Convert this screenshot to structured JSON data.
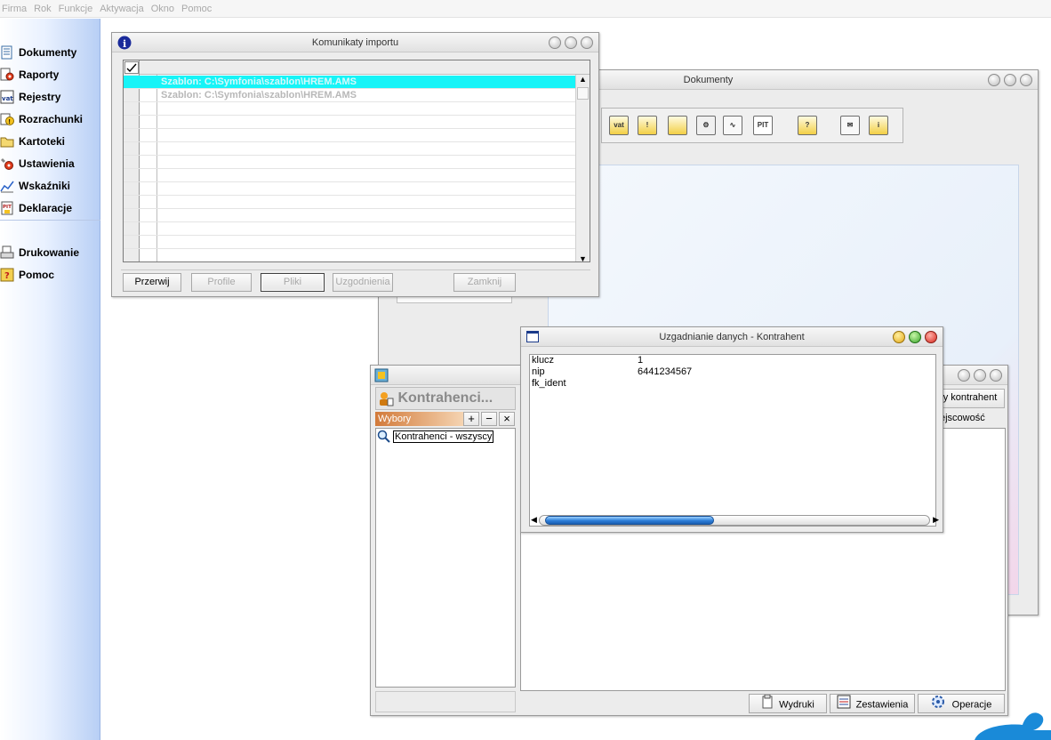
{
  "menu": [
    "Firma",
    "Rok",
    "Funkcje",
    "Aktywacja",
    "Okno",
    "Pomoc"
  ],
  "nav": {
    "items": [
      {
        "label": "Dokumenty",
        "icon": "document-list-icon"
      },
      {
        "label": "Raporty",
        "icon": "report-gear-icon"
      },
      {
        "label": "Rejestry",
        "icon": "vat-register-icon"
      },
      {
        "label": "Rozrachunki",
        "icon": "settlement-warning-icon"
      },
      {
        "label": "Kartoteki",
        "icon": "folder-icon"
      },
      {
        "label": "Ustawienia",
        "icon": "settings-gear-icon"
      },
      {
        "label": "Wskaźniki",
        "icon": "chart-line-icon"
      },
      {
        "label": "Deklaracje",
        "icon": "pit-declaration-icon"
      }
    ],
    "bottom_items": [
      {
        "label": "Drukowanie",
        "icon": "printer-icon"
      },
      {
        "label": "Pomoc",
        "icon": "help-icon"
      }
    ]
  },
  "import_window": {
    "title": "Komunikaty importu",
    "rows": [
      "Szablon: C:\\Symfonia\\szablon\\HREM.AMS",
      "Szablon: C:\\Symfonia\\szablon\\HREM.AMS"
    ],
    "buttons": {
      "przerwij": "Przerwij",
      "profile": "Profile",
      "pliki": "Pliki",
      "uzgodnienia": "Uzgodnienia",
      "zamknij": "Zamknij"
    }
  },
  "documents_window": {
    "title": "Dokumenty"
  },
  "contractors_window": {
    "section_title": "Kontrahenci...",
    "wybory_label": "Wybory",
    "tree_item": "Kontrahenci - wszyscy",
    "new_contractor": "y kontrahent",
    "column_city": "ejscowość",
    "footer": {
      "wydruki": "Wydruki",
      "zestawienia": "Zestawienia",
      "operacje": "Operacje"
    }
  },
  "reconcile_window": {
    "title": "Uzgadnianie danych - Kontrahent",
    "fields": [
      {
        "key": "klucz",
        "value": "1"
      },
      {
        "key": "nip",
        "value": "6441234567"
      },
      {
        "key": "fk_ident",
        "value": ""
      }
    ]
  },
  "colors": {
    "selection": "#17f4f7",
    "nav_gradient_end": "#b8cff5",
    "scroll_thumb": "#2d7ed8"
  }
}
